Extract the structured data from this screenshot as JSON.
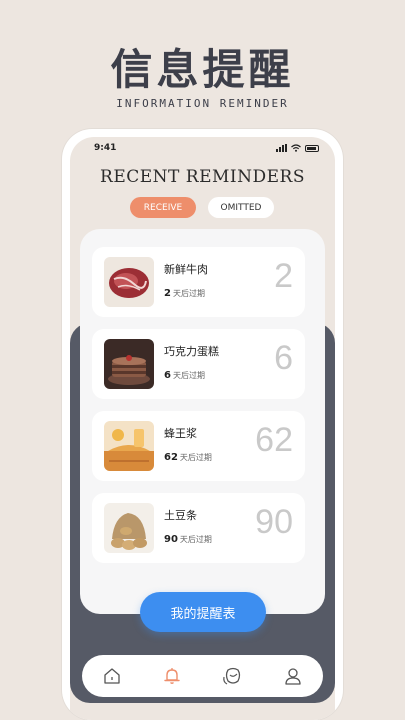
{
  "hero": {
    "title": "信息提醒",
    "subtitle": "INFORMATION REMINDER"
  },
  "status_bar": {
    "time": "9:41"
  },
  "screen": {
    "title": "RECENT REMINDERS",
    "tabs": [
      {
        "label": "RECEIVE",
        "active": true
      },
      {
        "label": "OMITTED",
        "active": false
      }
    ]
  },
  "reminders": [
    {
      "name": "新鲜牛肉",
      "days": "2",
      "suffix": "天后过期",
      "big": "2",
      "image": "beef"
    },
    {
      "name": "巧克力蛋糕",
      "days": "6",
      "suffix": "天后过期",
      "big": "6",
      "image": "chocolate-cake"
    },
    {
      "name": "蜂王浆",
      "days": "62",
      "suffix": "天后过期",
      "big": "62",
      "image": "royal-jelly"
    },
    {
      "name": "土豆条",
      "days": "90",
      "suffix": "天后过期",
      "big": "90",
      "image": "potatoes"
    }
  ],
  "fab": {
    "label": "我的提醒表"
  },
  "nav": [
    {
      "icon": "home-icon",
      "active": false
    },
    {
      "icon": "bell-icon",
      "active": true
    },
    {
      "icon": "profile-face-icon",
      "active": false
    },
    {
      "icon": "user-icon",
      "active": false
    }
  ],
  "colors": {
    "accent_orange": "#ee8e6b",
    "primary_blue": "#3d8ef0",
    "dark_panel": "#565a66",
    "background": "#ede6e0"
  }
}
